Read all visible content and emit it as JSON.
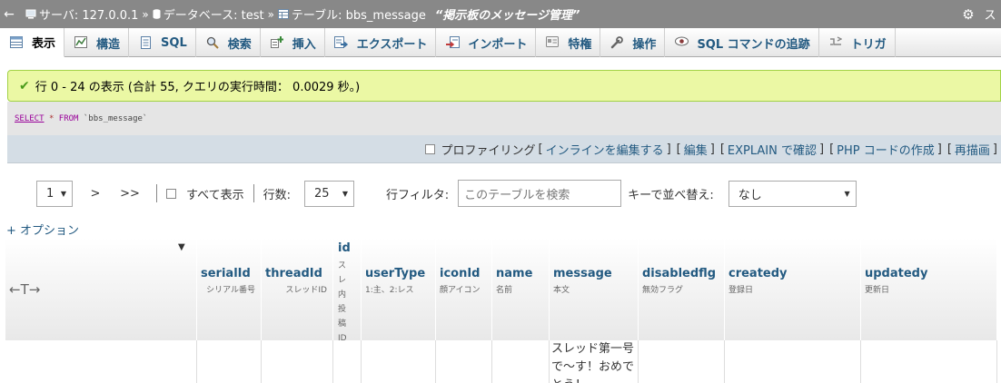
{
  "breadcrumb": {
    "server": "サーバ: 127.0.0.1",
    "database": "データベース: test",
    "table": "テーブル: bbs_message",
    "table_comment": "“掲示板のメッセージ管理”",
    "separator": "»"
  },
  "window_controls": {
    "settings": "⚙",
    "collapse": "ス"
  },
  "tabs": [
    {
      "label": "表示",
      "icon": "browse-icon"
    },
    {
      "label": "構造",
      "icon": "structure-icon"
    },
    {
      "label": "SQL",
      "icon": "sql-icon"
    },
    {
      "label": "検索",
      "icon": "search-icon"
    },
    {
      "label": "挿入",
      "icon": "insert-icon"
    },
    {
      "label": "エクスポート",
      "icon": "export-icon"
    },
    {
      "label": "インポート",
      "icon": "import-icon"
    },
    {
      "label": "特権",
      "icon": "privileges-icon"
    },
    {
      "label": "操作",
      "icon": "operations-icon"
    },
    {
      "label": "SQL コマンドの追跡",
      "icon": "tracking-icon"
    },
    {
      "label": "トリガ",
      "icon": "triggers-icon"
    }
  ],
  "notice": {
    "text": "行 0 - 24 の表示 (合計 55, クエリの実行時間： 0.0029 秒。)",
    "color": "#ebf8a4"
  },
  "sql": {
    "select": "SELECT",
    "star": "*",
    "from": "FROM",
    "table": "`bbs_message`"
  },
  "sql_links": {
    "profiling": "プロファイリング",
    "inline_edit": "インラインを編集する",
    "edit": "編集",
    "explain": "EXPLAIN で確認",
    "php_code": "PHP コードの作成",
    "refresh": "再描画"
  },
  "navigation": {
    "page": "1",
    "next": ">",
    "last": ">>",
    "show_all": "すべて表示",
    "rows_label": "行数:",
    "rows_value": "25",
    "filter_label": "行フィルタ:",
    "filter_placeholder": "このテーブルを検索",
    "sort_label": "キーで並べ替え:",
    "sort_value": "なし"
  },
  "options_link": "+ オプション",
  "table": {
    "arrows": "←T→",
    "columns": [
      {
        "name": "serialId",
        "comment": "シリアル番号"
      },
      {
        "name": "threadId",
        "comment": "スレッドID"
      },
      {
        "name": "id",
        "comment": "スレ内投稿ID"
      },
      {
        "name": "userType",
        "comment": "1:主、2:レス"
      },
      {
        "name": "iconId",
        "comment": "顔アイコン"
      },
      {
        "name": "name",
        "comment": "名前"
      },
      {
        "name": "message",
        "comment": "本文"
      },
      {
        "name": "disabledflg",
        "comment": "無効フラグ"
      },
      {
        "name": "createdy",
        "comment": "登録日"
      },
      {
        "name": "updatedy",
        "comment": "更新日"
      }
    ],
    "first_row_message": "スレッド第一号で～す！おめでとう！"
  }
}
